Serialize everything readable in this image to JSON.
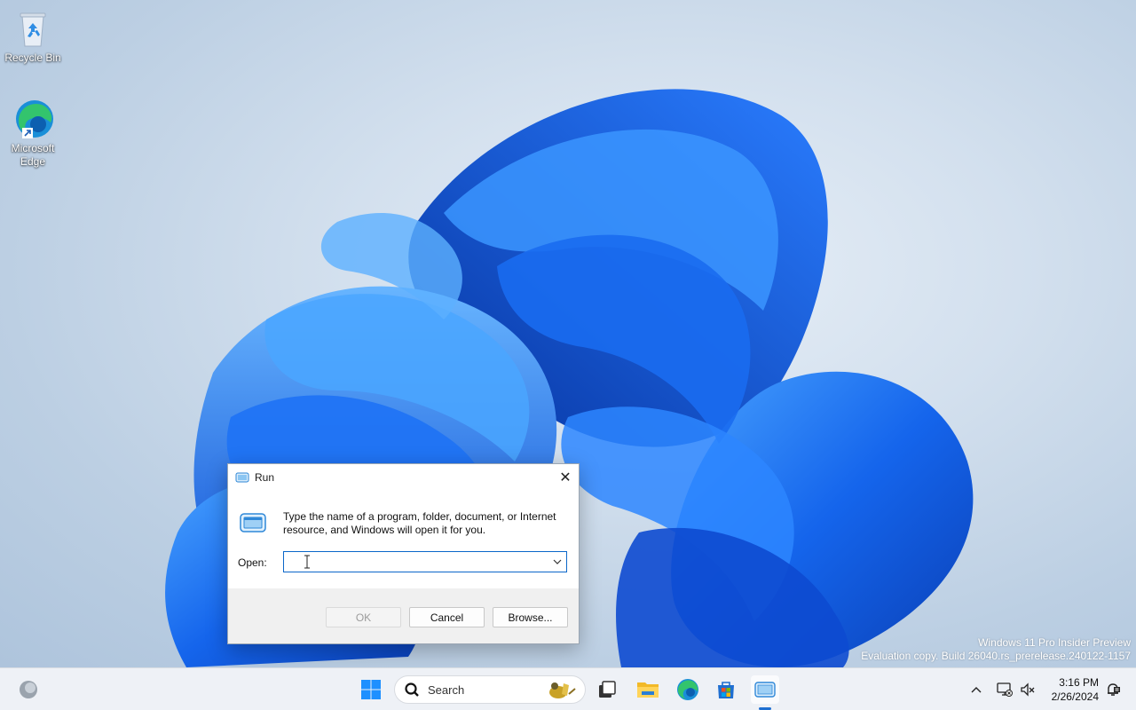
{
  "desktop": {
    "icons": [
      {
        "label": "Recycle Bin"
      },
      {
        "label": "Microsoft Edge"
      }
    ],
    "watermark": {
      "line1": "Windows 11 Pro Insider Preview",
      "line2": "Evaluation copy. Build 26040.rs_prerelease.240122-1157"
    }
  },
  "run_dialog": {
    "title": "Run",
    "close_icon": "close-icon",
    "description": "Type the name of a program, folder, document, or Internet resource, and Windows will open it for you.",
    "open_label": "Open:",
    "open_value": "",
    "buttons": {
      "ok": "OK",
      "cancel": "Cancel",
      "browse": "Browse..."
    },
    "ok_enabled": false
  },
  "taskbar": {
    "search_placeholder": "Search",
    "clock": {
      "time": "3:16 PM",
      "date": "2/26/2024"
    },
    "pinned": [
      "widgets-icon",
      "start-icon",
      "task-view-icon",
      "file-explorer-icon",
      "edge-icon",
      "store-icon",
      "run-icon"
    ],
    "tray": [
      "chevron-up-icon",
      "network-icon",
      "volume-muted-icon",
      "notification-icon"
    ]
  },
  "colors": {
    "accent": "#0b67c9",
    "taskbar_bg": "#eef1f6"
  }
}
